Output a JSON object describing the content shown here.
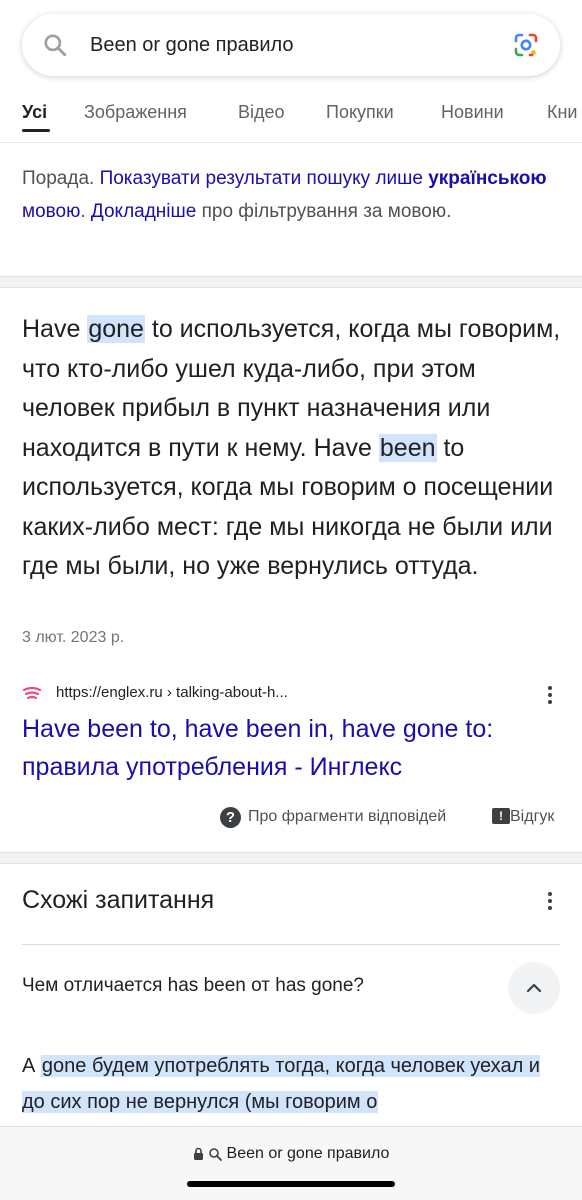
{
  "search": {
    "query": "Been or gone правило",
    "icon": "search-icon",
    "lens_icon": "google-lens-icon"
  },
  "tabs": [
    {
      "label": "Усі",
      "active": true
    },
    {
      "label": "Зображення",
      "active": false
    },
    {
      "label": "Відео",
      "active": false
    },
    {
      "label": "Покупки",
      "active": false
    },
    {
      "label": "Новини",
      "active": false
    },
    {
      "label": "Кни",
      "active": false
    }
  ],
  "tip": {
    "prefix": "Порада. ",
    "link1": "Показувати результати пошуку лише ",
    "link_bold": "українською",
    "link2": " мовою",
    "sep": ". ",
    "more_link": "Докладніше",
    "suffix": " про фільтрування за мовою."
  },
  "snippet": {
    "p1_start": "Have ",
    "p1_hl": "gone",
    "p1_rest": " to используется, когда мы говорим, что кто-либо ушел куда-либо, при этом человек прибыл в пункт назначения или находится в пути к нему. ",
    "p2_start": "Have ",
    "p2_hl": "been",
    "p2_rest": " to используется, когда мы говорим о посещении каких-либо мест: где мы никогда не были или где мы были, но уже вернулись оттуда.",
    "date": "3 лют. 2023 р.",
    "source_url": "https://englex.ru › talking-about-h...",
    "title": "Have been to, have been in, have gone to: правила употребления - Инглекс",
    "about_label": "Про фрагменти відповідей",
    "feedback_label": "Відгук"
  },
  "related": {
    "title": "Схожі запитання",
    "question": "Чем отличается has been от has gone?",
    "answer_start": "А ",
    "answer_hl": "gone будем употреблять тогда, когда человек уехал и до сих пор не вернулся (мы говорим о"
  },
  "bottom": {
    "url_text": "Been or gone правило"
  },
  "colors": {
    "link": "#1a0dab",
    "highlight": "#d2e3fc",
    "muted": "#4d5156"
  }
}
